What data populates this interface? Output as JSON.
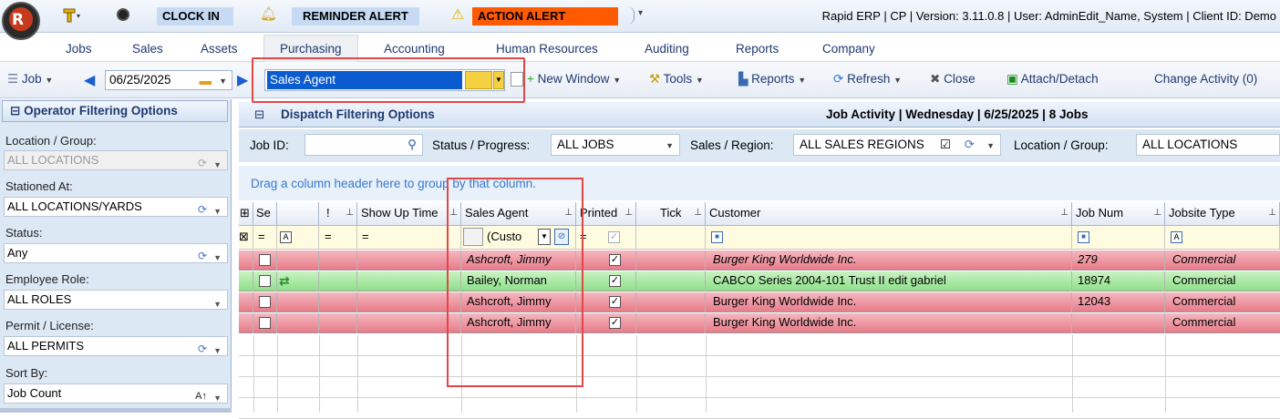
{
  "titlebar": {
    "clock_in": "CLOCK IN",
    "reminder": "REMINDER ALERT",
    "action": "ACTION ALERT",
    "title": "Rapid ERP | CP | Version: 3.11.0.8 | User: AdminEdit_Name, System | Client ID: Demo",
    "logo_text": "R"
  },
  "menu": {
    "items": [
      "Jobs",
      "Sales",
      "Assets",
      "Purchasing",
      "Accounting",
      "Human Resources",
      "Auditing",
      "Reports",
      "Company"
    ]
  },
  "toolbar": {
    "job": "Job",
    "date": "06/25/2025",
    "sales_agent": "Sales Agent",
    "new_window": "New Window",
    "tools": "Tools",
    "reports": "Reports",
    "refresh": "Refresh",
    "close": "Close",
    "attach": "Attach/Detach",
    "change_activity": "Change Activity (0)"
  },
  "left_panel": {
    "header": "Operator Filtering Options",
    "location_label": "Location / Group:",
    "location_value": "ALL LOCATIONS",
    "stationed_label": "Stationed At:",
    "stationed_value": "ALL LOCATIONS/YARDS",
    "status_label": "Status:",
    "status_value": "Any",
    "role_label": "Employee Role:",
    "role_value": "ALL ROLES",
    "permit_label": "Permit / License:",
    "permit_value": "ALL PERMITS",
    "sort_label": "Sort By:",
    "sort_value": "Job Count"
  },
  "dispatch": {
    "header": "Dispatch Filtering Options",
    "activity": "Job Activity | Wednesday | 6/25/2025 | 8 Jobs",
    "job_id_label": "Job ID:",
    "status_label": "Status / Progress:",
    "status_value": "ALL JOBS",
    "sales_label": "Sales / Region:",
    "sales_value": "ALL SALES REGIONS",
    "location_label": "Location / Group:",
    "location_value": "ALL LOCATIONS",
    "group_hint": "Drag a column header here to group by that column."
  },
  "grid": {
    "headers": {
      "se": "Se",
      "excl": "!",
      "show_up": "Show Up Time",
      "sales_agent": "Sales Agent",
      "printed": "Printed",
      "tick": "Tick",
      "customer": "Customer",
      "job_num": "Job Num",
      "jobsite_type": "Jobsite Type"
    },
    "filter_custom": "(Custo",
    "rows": [
      {
        "agent": "Ashcroft, Jimmy",
        "customer": "Burger King Worldwide Inc.",
        "job": "279",
        "type": "Commercial",
        "color": "red",
        "italic": true,
        "icon": false
      },
      {
        "agent": "Bailey, Norman",
        "customer": "CABCO Series 2004-101 Trust II edit gabriel",
        "job": "18974",
        "type": "Commercial",
        "color": "green",
        "italic": false,
        "icon": true
      },
      {
        "agent": "Ashcroft, Jimmy",
        "customer": "Burger King Worldwide Inc.",
        "job": "12043",
        "type": "Commercial",
        "color": "red",
        "italic": false,
        "icon": false
      },
      {
        "agent": "Ashcroft, Jimmy",
        "customer": "Burger King Worldwide Inc.",
        "job": "",
        "type": "Commercial",
        "color": "red",
        "italic": false,
        "icon": false
      }
    ]
  }
}
